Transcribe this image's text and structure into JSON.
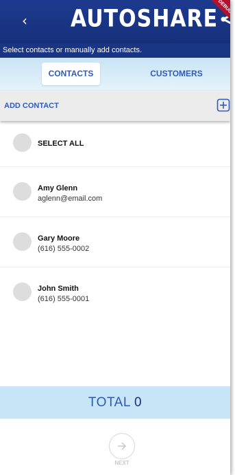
{
  "header": {
    "back_icon": "chevron-left-icon",
    "back_glyph": "‹",
    "logo_text": "AUTOSHARE",
    "logo_icon": "share-icon",
    "ribbon_text": "DEBUG",
    "subtitle": "Select contacts or manually add contacts."
  },
  "tabs": [
    {
      "label": "CONTACTS",
      "active": true
    },
    {
      "label": "CUSTOMERS",
      "active": false
    }
  ],
  "add_contact": {
    "label": "ADD CONTACT",
    "icon": "plus-square-icon"
  },
  "list": {
    "select_all_label": "SELECT ALL",
    "contacts": [
      {
        "name": "Amy Glenn",
        "detail": "aglenn@email.com"
      },
      {
        "name": "Gary Moore",
        "detail": "(616) 555-0002"
      },
      {
        "name": "John Smith",
        "detail": "(616) 555-0001"
      }
    ]
  },
  "total": {
    "label": "TOTAL",
    "value": "0"
  },
  "next": {
    "label": "NEXT",
    "icon": "arrow-right-circle-icon"
  },
  "colors": {
    "header_bg": "#1e3a8f",
    "accent_blue": "#2e5bb8",
    "total_bg": "#c7e5f6",
    "tab_bar_bg": "#d6ecf8"
  }
}
